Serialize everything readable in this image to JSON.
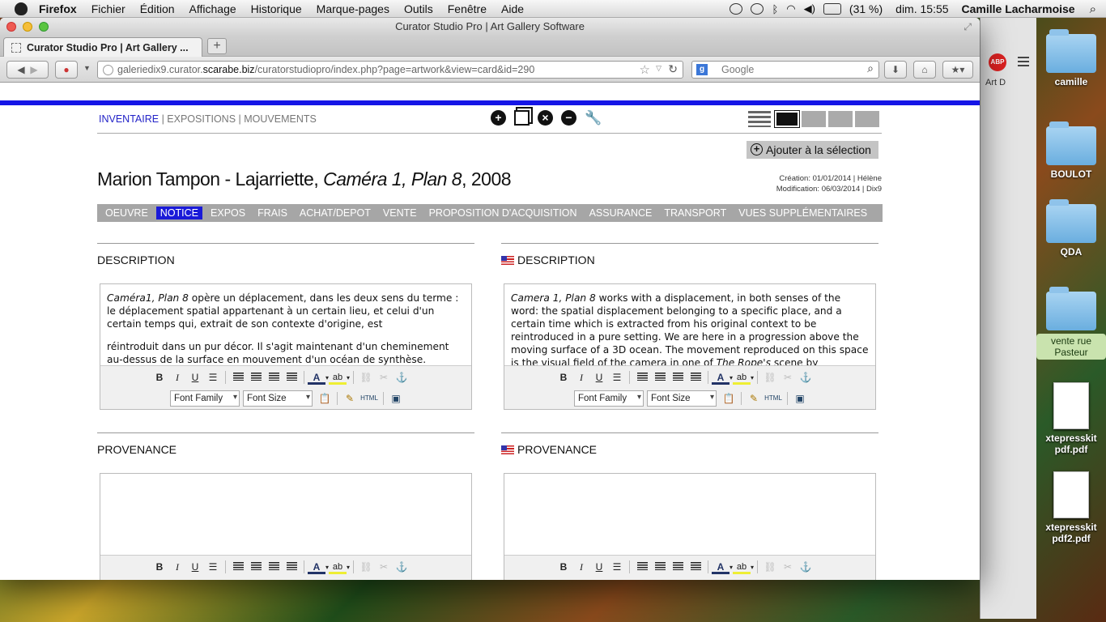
{
  "menubar": {
    "app": "Firefox",
    "items": [
      "Fichier",
      "Édition",
      "Affichage",
      "Historique",
      "Marque-pages",
      "Outils",
      "Fenêtre",
      "Aide"
    ],
    "battery": "(31 %)",
    "clock": "dim. 15:55",
    "user": "Camille Lacharmoise"
  },
  "desktop": {
    "icons": [
      "camille",
      "BOULOT",
      "QDA",
      "vente rue Pasteur",
      "xtepresskit pdf.pdf",
      "xtepresskit pdf2.pdf"
    ],
    "bg_window_text": "Art D"
  },
  "browser": {
    "window_title": "Curator Studio Pro | Art Gallery Software",
    "tab_title": "Curator Studio Pro | Art Gallery ...",
    "new_tab": "+",
    "url_pre": "galeriedix9.curator.",
    "url_domain": "scarabe.biz",
    "url_post": "/curatorstudiopro/index.php?page=artwork&view=card&id=290",
    "search_placeholder": "Google"
  },
  "page": {
    "topnav": {
      "inventaire": "INVENTAIRE",
      "sep": " | ",
      "expositions": "EXPOSITIONS",
      "mouvements": "MOUVEMENTS"
    },
    "add_selection": "Ajouter à la sélection",
    "creation": "Création: 01/01/2014 | Hélène",
    "modification": "Modification: 06/03/2014 | Dix9",
    "title_artist": "Marion Tampon - Lajarriette, ",
    "title_work": "Caméra 1, Plan 8",
    "title_year": ", 2008",
    "tabs": [
      "OEUVRE",
      "NOTICE",
      "EXPOS",
      "FRAIS",
      "ACHAT/DEPOT",
      "VENTE",
      "PROPOSITION D'ACQUISITION",
      "ASSURANCE",
      "TRANSPORT",
      "VUES SUPPLÉMENTAIRES"
    ],
    "active_tab": "NOTICE",
    "sections": {
      "desc_fr": "DESCRIPTION",
      "desc_en": "DESCRIPTION",
      "prov_fr": "PROVENANCE",
      "prov_en": "PROVENANCE"
    },
    "desc_fr_text": {
      "p1_italic": "Caméra1, Plan 8",
      "p1_rest": " opère un déplacement, dans les deux sens du terme : le déplacement spatial appartenant à un certain lieu, et celui d'un certain temps qui,  extrait de son contexte d'origine, est",
      "p2": "réintroduit dans un pur décor. Il s'agit maintenant d'un cheminement au-dessus de la surface en mouvement d'un océan de synthèse."
    },
    "desc_en_text": {
      "p1_italic": "Camera 1, Plan 8",
      "p1_rest": " works with a displacement, in both senses of the word: the spatial displacement belonging to a specific place, and a certain time which is extracted from his original context to be reintroduced in a pure setting. We are here in a progression above the moving surface of a 3D ocean. The movement reproduced on this space is the visual field of the camera in one of ",
      "p1_italic2": "The Rope's",
      "p1_end": " scene by"
    },
    "toolbar": {
      "bold": "B",
      "italic": "I",
      "underline": "U",
      "font_family": "Font Family",
      "font_size": "Font Size",
      "html": "HTML",
      "text_color": "A",
      "highlight": "ab"
    }
  }
}
